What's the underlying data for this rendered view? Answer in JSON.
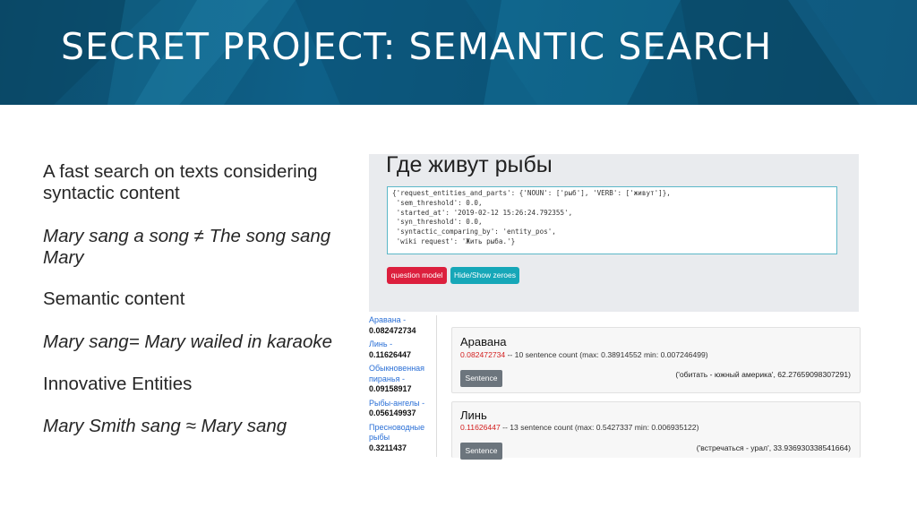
{
  "slide": {
    "title": "SECRET PROJECT: SEMANTIC SEARCH"
  },
  "left_text": {
    "p1": "A fast search on texts considering syntactic content",
    "p2": "Mary sang a song ≠ The song sang Mary",
    "p3": "Semantic content",
    "p4": "Mary sang= Mary wailed in karaoke",
    "p5": "Innovative Entities",
    "p6": "Mary Smith sang ≈ Mary sang"
  },
  "app": {
    "query": "Где живут рыбы",
    "json_lines": [
      "{'request_entities_and_parts': {'NOUN': ['рыб'], 'VERB': ['живут']},",
      " 'sem_threshold': 0.0,",
      " 'started_at': '2019-02-12 15:26:24.792355',",
      " 'syn_threshold': 0.0,",
      " 'syntactic_comparing_by': 'entity_pos',",
      " 'wiki request': 'Жить рыба.'}"
    ],
    "buttons": {
      "question_model": "question model",
      "hide_show_zeroes": "Hide/Show zeroes"
    },
    "sidebar": [
      {
        "name": "Аравана -",
        "value": "0.082472734"
      },
      {
        "name": "Линь -",
        "value": "0.11626447",
        "inline": true
      },
      {
        "name": "Обыкновенная пиранья -",
        "value": "0.09158917"
      },
      {
        "name": "Рыбы-ангелы -",
        "value": "0.056149937"
      },
      {
        "name": "Пресноводные рыбы",
        "value": "0.3211437"
      }
    ],
    "results": [
      {
        "title": "Аравана",
        "score": "0.082472734",
        "details": " -- 10 sentence count (max: 0.38914552 min: 0.007246499)",
        "button": "Sentence",
        "entity": "('обитать - южный америка', 62.27659098307291)"
      },
      {
        "title": "Линь",
        "score": "0.11626447",
        "details": " -- 13 sentence count (max: 0.5427337 min: 0.006935122)",
        "button": "Sentence",
        "entity": "('встречаться - урал', 33.936930338541664)"
      }
    ]
  }
}
